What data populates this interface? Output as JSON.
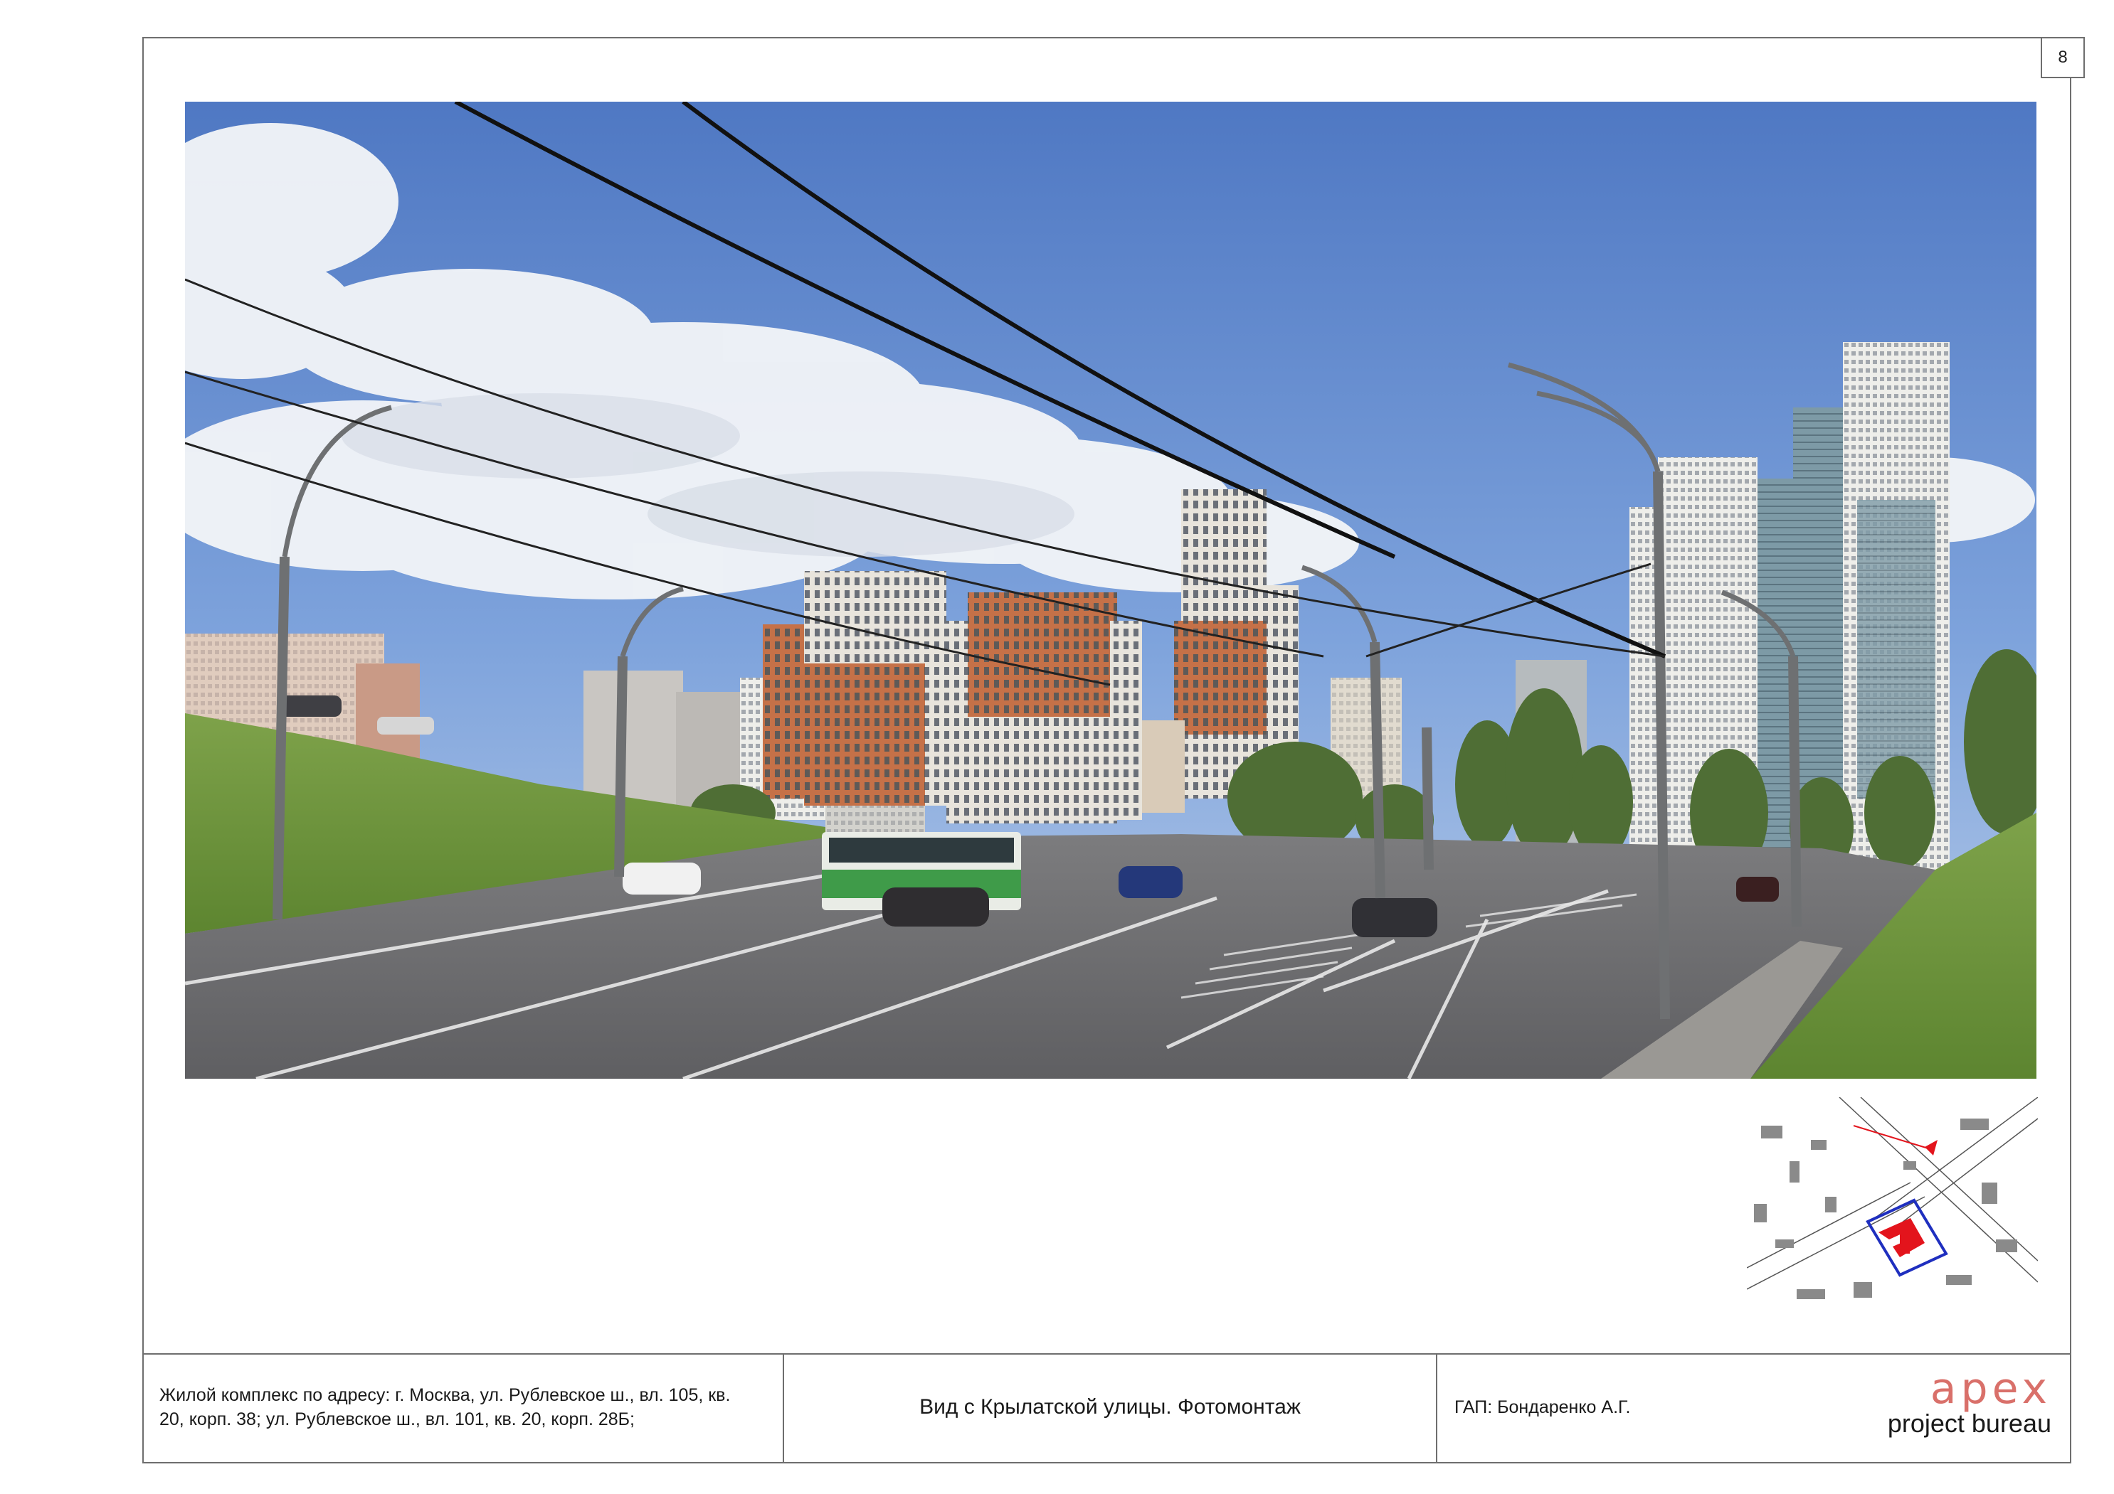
{
  "page": {
    "number": "8"
  },
  "photo": {
    "icon": "street-photomontage-image"
  },
  "site_map": {
    "icon": "site-location-map",
    "accent": "#e3141c",
    "outline": "#1f2fbf"
  },
  "title_block": {
    "address_line1": "Жилой комплекс по адресу: г. Москва, ул. Рублевское ш., вл. 105, кв.",
    "address_line2": "20, корп. 38; ул. Рублевское ш., вл. 101, кв. 20, корп. 28Б;",
    "sheet_title": "Вид с Крылатской улицы. Фотомонтаж",
    "chief_architect": "ГАП: Бондаренко А.Г.",
    "logo_main": "apex",
    "logo_sub": "project bureau",
    "logo_color": "#d9706a"
  }
}
